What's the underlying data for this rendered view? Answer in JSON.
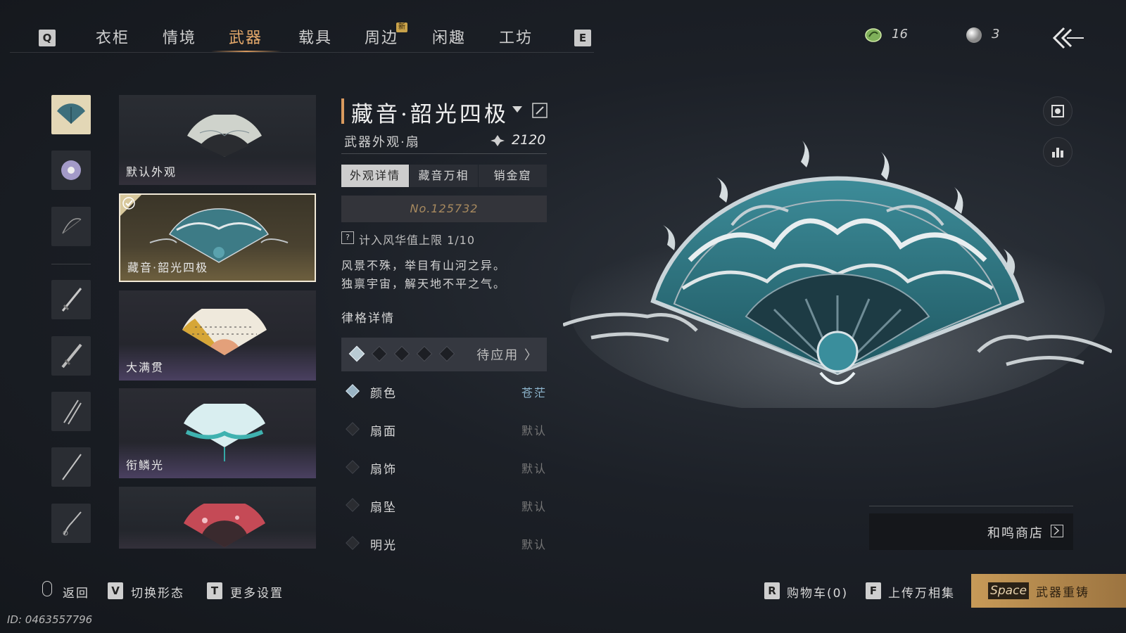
{
  "nav": {
    "left_key": "Q",
    "right_key": "E",
    "tabs": [
      "衣柜",
      "情境",
      "武器",
      "载具",
      "周边",
      "闲趣",
      "工坊"
    ],
    "active_tab": "武器",
    "new_badge": "新"
  },
  "currency": {
    "jade": "16",
    "pearl": "3"
  },
  "thumbs": [
    "fan-icon",
    "fan-icon",
    "bow-icon",
    "sword-icon",
    "sword-icon",
    "twin-blades-icon",
    "spear-icon",
    "whip-icon"
  ],
  "cards": [
    {
      "name": "默认外观"
    },
    {
      "name": "藏音·韶光四极",
      "selected": true
    },
    {
      "name": "大满贯"
    },
    {
      "name": "衔鳞光"
    },
    {
      "name": ""
    }
  ],
  "detail": {
    "title": "藏音·韶光四极",
    "subtitle": "武器外观·扇",
    "score": "2120",
    "tabs": [
      "外观详情",
      "藏音万相",
      "销金窟"
    ],
    "active_tab": "外观详情",
    "serial": "No.125732",
    "cap_note": "计入风华值上限 1/10",
    "desc_lines": [
      "风景不殊，举目有山河之异。",
      "独禀宇宙，解天地不平之气。"
    ],
    "section_title": "律格详情",
    "slots_active": 1,
    "slots_total": 5,
    "pending": "待应用 〉",
    "props": [
      {
        "name": "颜色",
        "value": "苍茫",
        "active": true
      },
      {
        "name": "扇面",
        "value": "默认"
      },
      {
        "name": "扇饰",
        "value": "默认"
      },
      {
        "name": "扇坠",
        "value": "默认"
      },
      {
        "name": "明光",
        "value": "默认"
      }
    ]
  },
  "shop": {
    "label": "和鸣商店"
  },
  "bottom": {
    "back": "返回",
    "switch_key": "V",
    "switch": "切换形态",
    "more_key": "T",
    "more": "更多设置",
    "cart_key": "R",
    "cart": "购物车(0)",
    "upload_key": "F",
    "upload": "上传万相集",
    "reforge_key": "Space",
    "reforge": "武器重铸"
  },
  "user_id": "ID: 0463557796",
  "colors": {
    "accent": "#d99a5e",
    "teal": "#2e7c86",
    "highlight": "#8fb7cf"
  }
}
